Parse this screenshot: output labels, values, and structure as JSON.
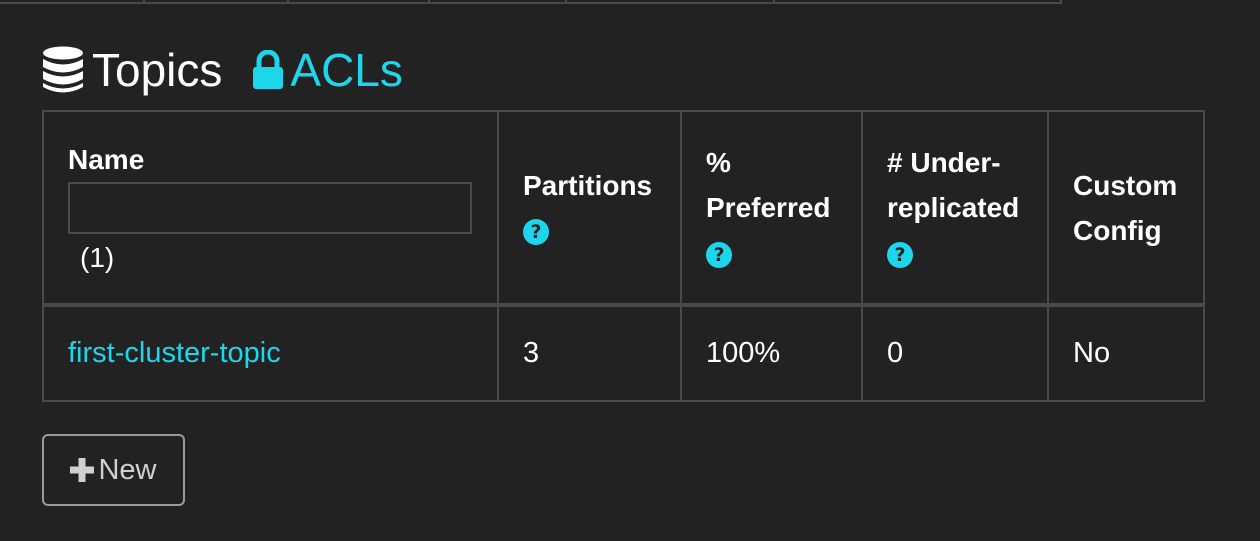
{
  "section": {
    "icon": "database-icon",
    "title": "Topics",
    "acls_icon": "lock-icon",
    "acls_label": "ACLs"
  },
  "table": {
    "headers": {
      "name": "Name",
      "filter_value": "",
      "count": "(1)",
      "partitions": "Partitions",
      "preferred_line1": "%",
      "preferred_line2": "Preferred",
      "under_line1": "# Under-",
      "under_line2": "replicated",
      "custom_line1": "Custom",
      "custom_line2": "Config",
      "help_icon": "question-circle-icon",
      "help_glyph": "?"
    },
    "rows": [
      {
        "name": "first-cluster-topic",
        "partitions": "3",
        "preferred": "100%",
        "under_replicated": "0",
        "custom_config": "No"
      }
    ]
  },
  "new_button": {
    "icon": "plus-icon",
    "label": "New"
  },
  "colors": {
    "background": "#222222",
    "accent": "#1dd6ec",
    "border": "#4a4a4a",
    "text": "#ffffff"
  }
}
